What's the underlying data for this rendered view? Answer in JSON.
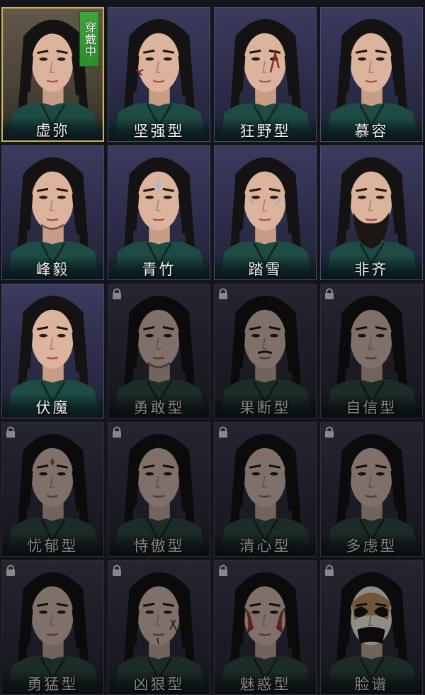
{
  "colors": {
    "selected_border": "#c8b25a",
    "badge_green": "#3fa63a",
    "robe": "#1e4c44"
  },
  "badge": {
    "label": "穿戴中"
  },
  "faces": [
    {
      "name": "虚弥",
      "locked": false,
      "worn": true,
      "marking": "none"
    },
    {
      "name": "坚强型",
      "locked": false,
      "worn": false,
      "marking": "scar-cheek"
    },
    {
      "name": "狂野型",
      "locked": false,
      "worn": false,
      "marking": "scar-eye"
    },
    {
      "name": "慕容",
      "locked": false,
      "worn": false,
      "marking": "none"
    },
    {
      "name": "峰毅",
      "locked": false,
      "worn": false,
      "marking": "stubble"
    },
    {
      "name": "青竹",
      "locked": false,
      "worn": false,
      "marking": "forehead-jewel"
    },
    {
      "name": "踏雪",
      "locked": false,
      "worn": false,
      "marking": "eye-paint"
    },
    {
      "name": "非齐",
      "locked": false,
      "worn": false,
      "marking": "beard"
    },
    {
      "name": "伏魔",
      "locked": false,
      "worn": false,
      "marking": "none"
    },
    {
      "name": "勇敢型",
      "locked": true,
      "worn": false,
      "marking": "stubble"
    },
    {
      "name": "果断型",
      "locked": true,
      "worn": false,
      "marking": "mustache"
    },
    {
      "name": "自信型",
      "locked": true,
      "worn": false,
      "marking": "none"
    },
    {
      "name": "忧郁型",
      "locked": true,
      "worn": false,
      "marking": "forehead-red"
    },
    {
      "name": "恃傲型",
      "locked": true,
      "worn": false,
      "marking": "none"
    },
    {
      "name": "清心型",
      "locked": true,
      "worn": false,
      "marking": "forehead-jewel"
    },
    {
      "name": "多虑型",
      "locked": true,
      "worn": false,
      "marking": "none"
    },
    {
      "name": "勇猛型",
      "locked": true,
      "worn": false,
      "marking": "none"
    },
    {
      "name": "凶狠型",
      "locked": true,
      "worn": false,
      "marking": "scar-face"
    },
    {
      "name": "魅惑型",
      "locked": true,
      "worn": false,
      "marking": "red-warpaint"
    },
    {
      "name": "脸谱",
      "locked": true,
      "worn": false,
      "marking": "opera-mask"
    }
  ]
}
